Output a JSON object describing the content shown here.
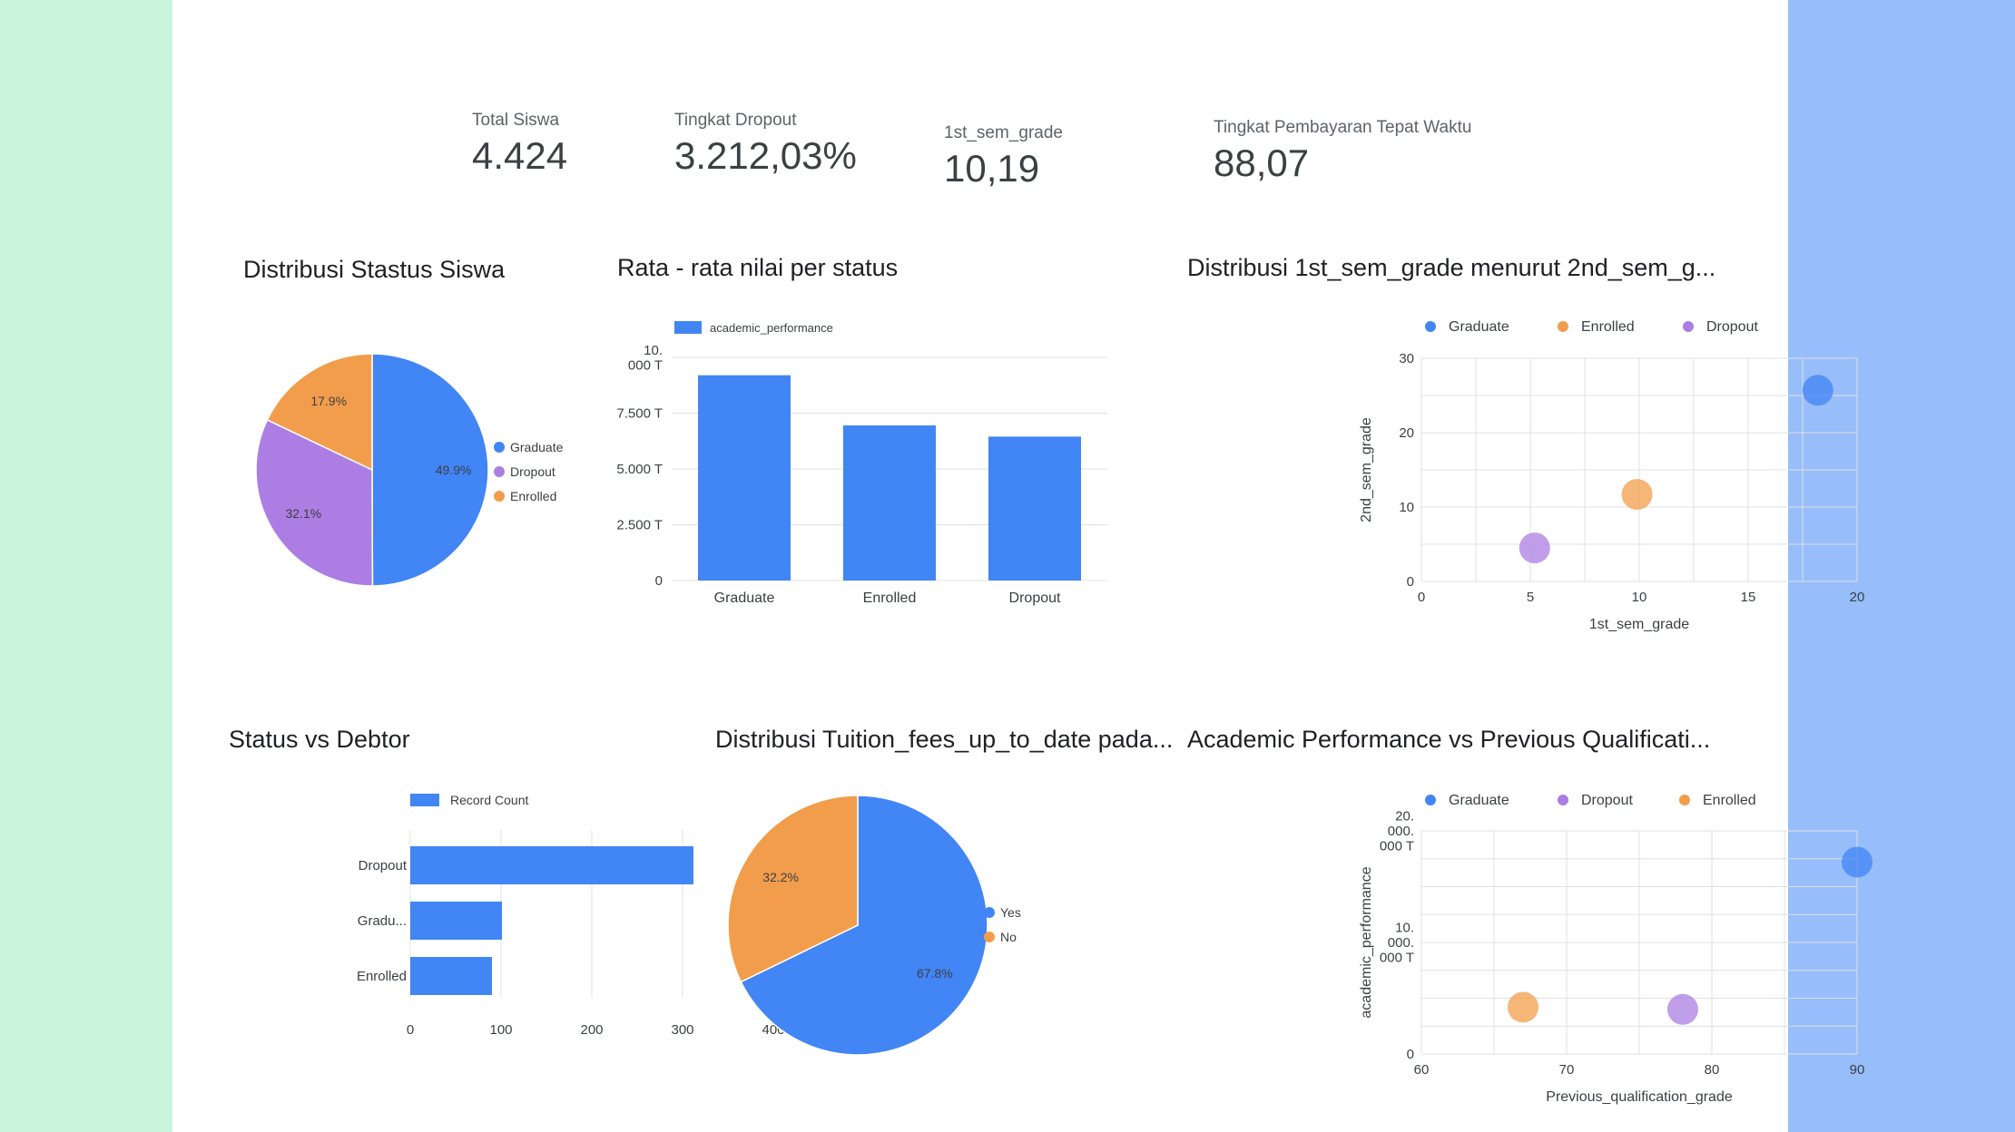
{
  "colors": {
    "bg_left": "#c8f5dc",
    "bg_right": "#97bdfa",
    "blue": "#4285f4",
    "orange": "#f29d4b",
    "purple": "#ac7ee3",
    "grid": "#e0e0e0"
  },
  "kpis": [
    {
      "label": "Total Siswa",
      "value": "4.424"
    },
    {
      "label": "Tingkat Dropout",
      "value": "3.212,03%"
    },
    {
      "label": "1st_sem_grade",
      "value": "10,19"
    },
    {
      "label": "Tingkat Pembayaran Tepat Waktu",
      "value": "88,07"
    }
  ],
  "chart_data": [
    {
      "type": "pie",
      "title": "Distribusi Stastus Siswa",
      "slices": [
        {
          "label": "Graduate",
          "value": 49.9,
          "display": "49.9%",
          "color": "#4285f4"
        },
        {
          "label": "Dropout",
          "value": 32.1,
          "display": "32.1%",
          "color": "#ac7ee3"
        },
        {
          "label": "Enrolled",
          "value": 17.9,
          "display": "17.9%",
          "color": "#f29d4b"
        }
      ],
      "legend": [
        "Graduate",
        "Dropout",
        "Enrolled"
      ],
      "legend_position": "right"
    },
    {
      "type": "bar",
      "title": "Rata - rata nilai per status",
      "categories": [
        "Graduate",
        "Enrolled",
        "Dropout"
      ],
      "series": [
        {
          "name": "academic_performance",
          "values": [
            9200,
            6950,
            6450
          ]
        }
      ],
      "ylim": [
        0,
        10000
      ],
      "yticks": [
        {
          "value": 0,
          "label": "0"
        },
        {
          "value": 2500,
          "label": "2.500 T"
        },
        {
          "value": 5000,
          "label": "5.000 T"
        },
        {
          "value": 7500,
          "label": "7.500 T"
        },
        {
          "value": 10000,
          "label": "10.\n000 T"
        }
      ],
      "legend_position": "top"
    },
    {
      "type": "scatter",
      "title": "Distribusi 1st_sem_grade menurut 2nd_sem_g...",
      "xlabel": "1st_sem_grade",
      "ylabel": "2nd_sem_grade",
      "xlim": [
        0,
        20
      ],
      "ylim": [
        0,
        30
      ],
      "xticks": [
        0,
        5,
        10,
        15,
        20
      ],
      "yticks": [
        0,
        10,
        20,
        30
      ],
      "series": [
        {
          "name": "Graduate",
          "color": "#4285f4",
          "x": 18.2,
          "y": 25.7
        },
        {
          "name": "Enrolled",
          "color": "#f29d4b",
          "x": 9.9,
          "y": 11.7
        },
        {
          "name": "Dropout",
          "color": "#ac7ee3",
          "x": 5.2,
          "y": 4.5
        }
      ],
      "legend_position": "top",
      "grid": true
    },
    {
      "type": "bar",
      "orientation": "horizontal",
      "title": "Status vs Debtor",
      "categories": [
        "Dropout",
        "Gradu...",
        "Enrolled"
      ],
      "series": [
        {
          "name": "Record Count",
          "values": [
            312,
            101,
            90
          ]
        }
      ],
      "xlim": [
        0,
        400
      ],
      "xticks": [
        0,
        100,
        200,
        300,
        400
      ],
      "legend_position": "top"
    },
    {
      "type": "pie",
      "title": "Distribusi Tuition_fees_up_to_date pada...",
      "slices": [
        {
          "label": "Yes",
          "value": 67.8,
          "display": "67.8%",
          "color": "#4285f4"
        },
        {
          "label": "No",
          "value": 32.2,
          "display": "32.2%",
          "color": "#f29d4b"
        }
      ],
      "legend": [
        "Yes",
        "No"
      ],
      "legend_position": "right"
    },
    {
      "type": "scatter",
      "title": "Academic Performance vs Previous Qualificati...",
      "xlabel": "Previous_qualification_grade",
      "ylabel": "academic_performance",
      "xlim": [
        60,
        90
      ],
      "ylim": [
        0,
        20000
      ],
      "xticks": [
        60,
        70,
        80,
        90
      ],
      "yticks": [
        {
          "value": 0,
          "label": "0"
        },
        {
          "value": 10000,
          "label": "10.\n000.\n000 T"
        },
        {
          "value": 20000,
          "label": "20.\n000.\n000 T"
        }
      ],
      "series": [
        {
          "name": "Graduate",
          "color": "#4285f4",
          "x": 90,
          "y": 17200
        },
        {
          "name": "Dropout",
          "color": "#ac7ee3",
          "x": 78,
          "y": 4000
        },
        {
          "name": "Enrolled",
          "color": "#f29d4b",
          "x": 67,
          "y": 4200
        }
      ],
      "legend_position": "top",
      "grid": true
    }
  ]
}
